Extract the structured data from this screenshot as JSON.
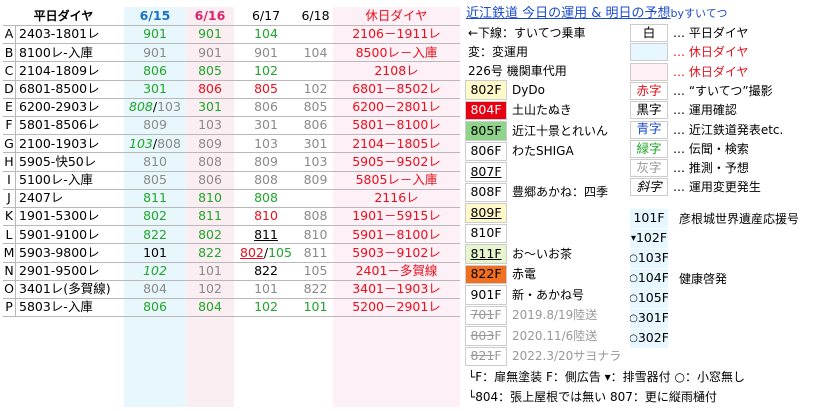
{
  "header": {
    "label": "平日ダイヤ",
    "dates": [
      "6/15",
      "6/16",
      "6/17",
      "6/18"
    ],
    "holiday": "休日ダイヤ",
    "title": "近江鉄道 今日の運用 & 明日の予想",
    "byline": "byすいてつ"
  },
  "colors": {
    "c615": "#1c72c4",
    "c616": "#e0226b",
    "green": "#1fa52a",
    "red": "#e8101c",
    "blue": "#1c4ccc"
  },
  "rows": [
    {
      "k": "A",
      "w": "2403-1801レ",
      "d1": {
        "t": "901",
        "c": "g"
      },
      "d2": {
        "t": "901",
        "c": "g"
      },
      "d3": {
        "t": "104",
        "c": "g"
      },
      "d4": {
        "t": "",
        "c": "k"
      },
      "h": "2106－1911レ"
    },
    {
      "k": "B",
      "w": "8100レ-入庫",
      "d1": {
        "t": "901",
        "c": "y"
      },
      "d2": {
        "t": "901",
        "c": "y"
      },
      "d3": {
        "t": "901",
        "c": "y"
      },
      "d4": {
        "t": "104",
        "c": "y"
      },
      "h": "8500レ－入庫"
    },
    {
      "k": "C",
      "w": "2104-1809レ",
      "d1": {
        "t": "806",
        "c": "g"
      },
      "d2": {
        "t": "805",
        "c": "g"
      },
      "d3": {
        "t": "102",
        "c": "g"
      },
      "d4": {
        "t": "",
        "c": "k"
      },
      "h": "2108レ"
    },
    {
      "k": "D",
      "w": "6801-8500レ",
      "d1": {
        "t": "301",
        "c": "g"
      },
      "d2": {
        "t": "806",
        "c": "r"
      },
      "d3": {
        "t": "805",
        "c": "r"
      },
      "d4": {
        "t": "102",
        "c": "y"
      },
      "h": "6801－8502レ"
    },
    {
      "k": "E",
      "w": "6200-2903レ",
      "d1": {
        "t": "808",
        "c": "g",
        "it": true,
        "x": "103"
      },
      "d2": {
        "t": "301",
        "c": "g"
      },
      "d3": {
        "t": "806",
        "c": "y"
      },
      "d4": {
        "t": "805",
        "c": "y"
      },
      "h": "6200－2801レ"
    },
    {
      "k": "F",
      "w": "5801-8506レ",
      "d1": {
        "t": "809",
        "c": "y"
      },
      "d2": {
        "t": "103",
        "c": "y"
      },
      "d3": {
        "t": "301",
        "c": "y"
      },
      "d4": {
        "t": "806",
        "c": "y"
      },
      "h": "5801－8100レ"
    },
    {
      "k": "G",
      "w": "2100-1903レ",
      "d1": {
        "t": "103",
        "c": "g",
        "it": true,
        "x": "808"
      },
      "d2": {
        "t": "809",
        "c": "y"
      },
      "d3": {
        "t": "103",
        "c": "y"
      },
      "d4": {
        "t": "301",
        "c": "y"
      },
      "h": "2104－1805レ"
    },
    {
      "k": "H",
      "w": "5905-快50レ",
      "d1": {
        "t": "810",
        "c": "y"
      },
      "d2": {
        "t": "808",
        "c": "y"
      },
      "d3": {
        "t": "809",
        "c": "y"
      },
      "d4": {
        "t": "103",
        "c": "y"
      },
      "h": "5905－9502レ"
    },
    {
      "k": "I",
      "w": "5100レ-入庫",
      "d1": {
        "t": "805",
        "c": "y"
      },
      "d2": {
        "t": "806",
        "c": "y"
      },
      "d3": {
        "t": "808",
        "c": "y"
      },
      "d4": {
        "t": "809",
        "c": "y"
      },
      "h": "5805レ－入庫"
    },
    {
      "k": "J",
      "w": "2407レ",
      "d1": {
        "t": "811",
        "c": "g"
      },
      "d2": {
        "t": "810",
        "c": "g"
      },
      "d3": {
        "t": "808",
        "c": "g"
      },
      "d4": {
        "t": "",
        "c": "k"
      },
      "h": "2116レ"
    },
    {
      "k": "K",
      "w": "1901-5300レ",
      "d1": {
        "t": "802",
        "c": "g"
      },
      "d2": {
        "t": "811",
        "c": "g"
      },
      "d3": {
        "t": "810",
        "c": "r"
      },
      "d4": {
        "t": "808",
        "c": "y"
      },
      "h": "1901－5915レ"
    },
    {
      "k": "L",
      "w": "5901-9100レ",
      "d1": {
        "t": "822",
        "c": "g"
      },
      "d2": {
        "t": "802",
        "c": "g"
      },
      "d3": {
        "t": "811",
        "c": "k",
        "u": true
      },
      "d4": {
        "t": "810",
        "c": "y"
      },
      "h": "5901－8100レ"
    },
    {
      "k": "M",
      "w": "5903-9800レ",
      "d1": {
        "t": "101",
        "c": "k"
      },
      "d2": {
        "t": "822",
        "c": "g"
      },
      "d3": {
        "t": "802",
        "c": "r",
        "u": true,
        "x": "105"
      },
      "d4": {
        "t": "811",
        "c": "y"
      },
      "h": "5903－9102レ"
    },
    {
      "k": "N",
      "w": "2901-9500レ",
      "d1": {
        "t": "102",
        "c": "g",
        "it": true
      },
      "d2": {
        "t": "101",
        "c": "y"
      },
      "d3": {
        "t": "822",
        "c": "k"
      },
      "d4": {
        "t": "105",
        "c": "y"
      },
      "h": "2401－多賀線"
    },
    {
      "k": "O",
      "w": "3401レ(多賀線)",
      "d1": {
        "t": "804",
        "c": "y"
      },
      "d2": {
        "t": "102",
        "c": "y"
      },
      "d3": {
        "t": "101",
        "c": "y"
      },
      "d4": {
        "t": "822",
        "c": "y"
      },
      "h": "3401－1903レ"
    },
    {
      "k": "P",
      "w": "5803レ-入庫",
      "d1": {
        "t": "806",
        "c": "g"
      },
      "d2": {
        "t": "804",
        "c": "g"
      },
      "d3": {
        "t": "102",
        "c": "g"
      },
      "d4": {
        "t": "101",
        "c": "g"
      },
      "h": "5200－2901レ"
    }
  ],
  "legend_top": [
    {
      "t": "←下線：すいてつ乗車"
    },
    {
      "t": "変：変運用"
    },
    {
      "t": "226号 機関車代用"
    }
  ],
  "fleet": [
    {
      "num": "802",
      "suffix": "F",
      "name": "DyDo",
      "bg": "#fff8c8",
      "fg": "#000"
    },
    {
      "num": "804",
      "suffix": "F",
      "name": "土山たぬき",
      "bg": "#e60012",
      "fg": "#fff"
    },
    {
      "num": "805",
      "suffix": "F",
      "name": "近江十景とれいん",
      "bg": "#8fd48a",
      "fg": "#000"
    },
    {
      "num": "806",
      "suffix": "F",
      "name": "わたSHIGA",
      "bg": "#ffffff",
      "fg": "#000"
    },
    {
      "num": "807",
      "suffix": "F",
      "name": "",
      "bg": "#ffffff",
      "fg": "#000",
      "u": true
    },
    {
      "num": "808",
      "suffix": "F",
      "name": "豊郷あかね：四季",
      "bg": "#ffffff",
      "fg": "#000"
    },
    {
      "num": "809",
      "suffix": "F",
      "name": "",
      "bg": "#fff8c8",
      "fg": "#000",
      "u": true
    },
    {
      "num": "810",
      "suffix": "F",
      "name": "",
      "bg": "#ffffff",
      "fg": "#000"
    },
    {
      "num": "811",
      "suffix": "F",
      "name": "お～いお茶",
      "bg": "#e8f6d0",
      "fg": "#000",
      "u": true
    },
    {
      "num": "822",
      "suffix": "F",
      "name": "赤電",
      "bg": "#f07020",
      "fg": "#000"
    },
    {
      "num": "901",
      "suffix": "F",
      "name": "新・あかね号",
      "bg": "#ffffff",
      "fg": "#000"
    },
    {
      "num": "701",
      "suffix": "F",
      "name": "2019.8/19陸送",
      "bg": "#ffffff",
      "fg": "#999",
      "s": true
    },
    {
      "num": "803",
      "suffix": "F",
      "name": "2020.11/6陸送",
      "bg": "#ffffff",
      "fg": "#999",
      "s": true
    },
    {
      "num": "821",
      "suffix": "F",
      "name": "2022.3/20サヨナラ",
      "bg": "#ffffff",
      "fg": "#999",
      "s": true
    }
  ],
  "keys": [
    {
      "swatch": "白",
      "text": "平日ダイヤ",
      "sc": "#000",
      "bg": "#ffffff"
    },
    {
      "swatch": "",
      "text": "休日ダイヤ",
      "sc": "#e8101c",
      "bg": "#e6f7ff",
      "tc": "#e8101c"
    },
    {
      "swatch": "",
      "text": "休日ダイヤ",
      "sc": "#e8101c",
      "bg": "#fff0f6",
      "tc": "#e8101c"
    },
    {
      "swatch": "赤字",
      "text": "“すいてつ”撮影",
      "sc": "#e8101c",
      "bg": "#ffffff"
    },
    {
      "swatch": "黒字",
      "text": "運用確認",
      "sc": "#000",
      "bg": "#ffffff"
    },
    {
      "swatch": "青字",
      "text": "近江鉄道発表etc.",
      "sc": "#1c4ccc",
      "bg": "#ffffff"
    },
    {
      "swatch": "緑字",
      "text": "伝聞・検索",
      "sc": "#1fa52a",
      "bg": "#ffffff"
    },
    {
      "swatch": "灰字",
      "text": "推測・予想",
      "sc": "#999",
      "bg": "#ffffff"
    },
    {
      "swatch": "斜字",
      "text": "運用変更発生",
      "sc": "#000",
      "bg": "#ffffff",
      "it": true
    }
  ],
  "cars": [
    {
      "pre": "",
      "num": "101",
      "suffix": "F",
      "note": "彦根城世界遺産応援号"
    },
    {
      "pre": "▾",
      "num": "102",
      "suffix": "F",
      "note": ""
    },
    {
      "pre": "○",
      "num": "103",
      "suffix": "F",
      "note": ""
    },
    {
      "pre": "○",
      "num": "104",
      "suffix": "F",
      "note": "健康啓発"
    },
    {
      "pre": "○",
      "num": "105",
      "suffix": "F",
      "note": ""
    },
    {
      "pre": "○",
      "num": "301",
      "suffix": "F",
      "note": ""
    },
    {
      "pre": "○",
      "num": "302",
      "suffix": "F",
      "note": ""
    }
  ],
  "footnotes": [
    "└F：扉無塗装  F：側広告 ▾：排雪器付 ○：小窓無し",
    "└804：張上屋根では無い  807：更に縦雨樋付"
  ]
}
